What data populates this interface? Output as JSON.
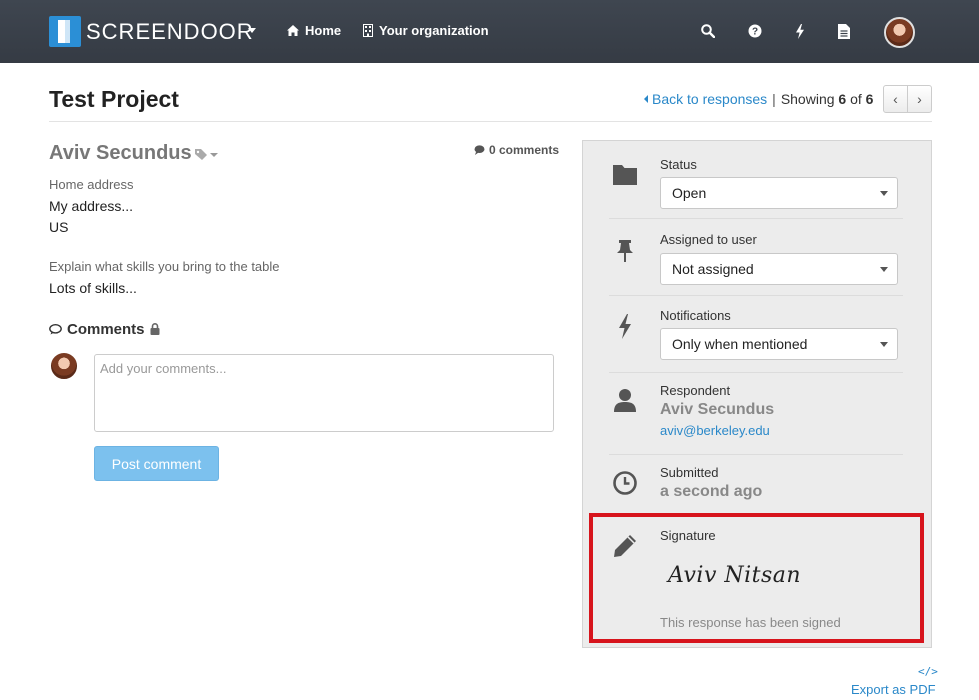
{
  "navbar": {
    "brand": "SCREENDOOR",
    "home_label": "Home",
    "org_label": "Your organization",
    "icons": [
      "search-icon",
      "question-icon",
      "bolt-icon",
      "document-icon"
    ]
  },
  "header": {
    "title": "Test Project",
    "back_label": "Back to responses",
    "separator": "|",
    "showing_prefix": "Showing",
    "showing_current": "6",
    "showing_of": "of",
    "showing_total": "6",
    "prev_label": "‹",
    "next_label": "›"
  },
  "response": {
    "name": "Aviv Secundus",
    "comments_count": "0 comments",
    "fields": [
      {
        "label": "Home address",
        "value_line1": "My address...",
        "value_line2": "US"
      },
      {
        "label": "Explain what skills you bring to the table",
        "value_line1": "Lots of skills..."
      }
    ]
  },
  "comments": {
    "title": "Comments",
    "placeholder": "Add your comments...",
    "post_label": "Post comment"
  },
  "sidebar": {
    "status_label": "Status",
    "status_value": "Open",
    "assigned_label": "Assigned to user",
    "assigned_value": "Not assigned",
    "notifications_label": "Notifications",
    "notifications_value": "Only when mentioned",
    "respondent_label": "Respondent",
    "respondent_name": "Aviv Secundus",
    "respondent_email": "aviv@berkeley.edu",
    "submitted_label": "Submitted",
    "submitted_value": "a second ago",
    "signature_label": "Signature",
    "signature_text": "Aviv Nitsan",
    "signed_note": "This response has been signed"
  },
  "footer": {
    "code_glyph": "</>",
    "export_label": "Export as PDF"
  },
  "colors": {
    "navbar": "#3b424b",
    "accent": "#2a88c9",
    "button": "#7cc1ee",
    "highlight": "#d7141c",
    "sidebar_bg": "#ececec"
  }
}
